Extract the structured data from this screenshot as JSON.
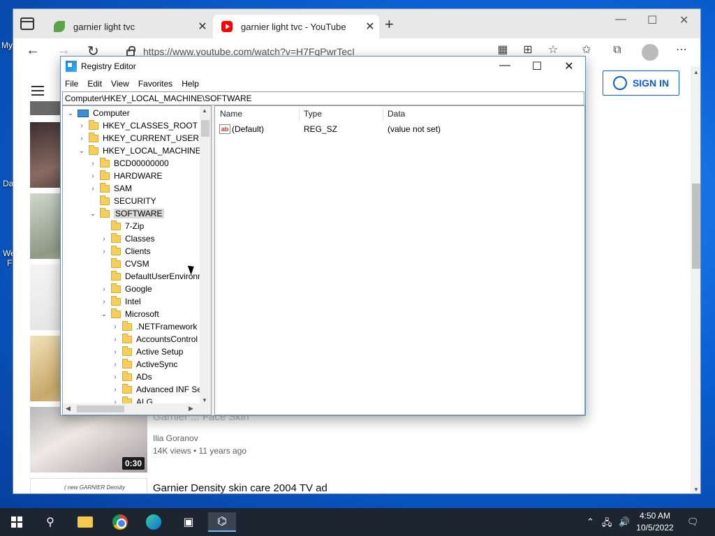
{
  "desktop": {
    "labels": [
      "My",
      "Da",
      "We",
      "F"
    ]
  },
  "browser": {
    "tabs": [
      {
        "title": "garnier light tvc",
        "icon": "leaf-icon"
      },
      {
        "title": "garnier light tvc - YouTube",
        "icon": "youtube-icon"
      }
    ],
    "url": "https://www.youtube.com/watch?v=H7FqPwrTecI",
    "window_controls": {
      "minimize": "—",
      "maximize": "☐",
      "close": "✕"
    }
  },
  "youtube": {
    "sign_in_label": "SIGN IN",
    "videos": [
      {
        "title": "Garnier ... Face Skin",
        "channel": "Ilia Goranov",
        "meta": "14K views • 11 years ago",
        "duration": "0:30"
      },
      {
        "title": "Garnier Density skin care 2004 TV ad",
        "thumb_text": "( new GARNIER Density"
      }
    ]
  },
  "regedit": {
    "title": "Registry Editor",
    "menu": [
      "File",
      "Edit",
      "View",
      "Favorites",
      "Help"
    ],
    "path": "Computer\\HKEY_LOCAL_MACHINE\\SOFTWARE",
    "tree": [
      {
        "label": "Computer",
        "level": 0,
        "expander": "v",
        "icon": "computer"
      },
      {
        "label": "HKEY_CLASSES_ROOT",
        "level": 1,
        "expander": ">",
        "icon": "folder"
      },
      {
        "label": "HKEY_CURRENT_USER",
        "level": 1,
        "expander": ">",
        "icon": "folder"
      },
      {
        "label": "HKEY_LOCAL_MACHINE",
        "level": 1,
        "expander": "v",
        "icon": "folder"
      },
      {
        "label": "BCD00000000",
        "level": 2,
        "expander": ">",
        "icon": "folder"
      },
      {
        "label": "HARDWARE",
        "level": 2,
        "expander": ">",
        "icon": "folder"
      },
      {
        "label": "SAM",
        "level": 2,
        "expander": ">",
        "icon": "folder"
      },
      {
        "label": "SECURITY",
        "level": 2,
        "expander": "",
        "icon": "folder"
      },
      {
        "label": "SOFTWARE",
        "level": 2,
        "expander": "v",
        "icon": "folder",
        "selected": true
      },
      {
        "label": "7-Zip",
        "level": 3,
        "expander": "",
        "icon": "folder"
      },
      {
        "label": "Classes",
        "level": 3,
        "expander": ">",
        "icon": "folder"
      },
      {
        "label": "Clients",
        "level": 3,
        "expander": ">",
        "icon": "folder"
      },
      {
        "label": "CVSM",
        "level": 3,
        "expander": "",
        "icon": "folder"
      },
      {
        "label": "DefaultUserEnvironn",
        "level": 3,
        "expander": "",
        "icon": "folder"
      },
      {
        "label": "Google",
        "level": 3,
        "expander": ">",
        "icon": "folder"
      },
      {
        "label": "Intel",
        "level": 3,
        "expander": ">",
        "icon": "folder"
      },
      {
        "label": "Microsoft",
        "level": 3,
        "expander": "v",
        "icon": "folder"
      },
      {
        "label": ".NETFramework",
        "level": 4,
        "expander": ">",
        "icon": "folder"
      },
      {
        "label": "AccountsControl",
        "level": 4,
        "expander": ">",
        "icon": "folder"
      },
      {
        "label": "Active Setup",
        "level": 4,
        "expander": ">",
        "icon": "folder"
      },
      {
        "label": "ActiveSync",
        "level": 4,
        "expander": ">",
        "icon": "folder"
      },
      {
        "label": "ADs",
        "level": 4,
        "expander": ">",
        "icon": "folder"
      },
      {
        "label": "Advanced INF Set",
        "level": 4,
        "expander": ">",
        "icon": "folder"
      },
      {
        "label": "ALG",
        "level": 4,
        "expander": ">",
        "icon": "folder"
      }
    ],
    "columns": [
      "Name",
      "Type",
      "Data"
    ],
    "values": [
      {
        "name": "(Default)",
        "type": "REG_SZ",
        "data": "(value not set)"
      }
    ]
  },
  "taskbar": {
    "time": "4:50 AM",
    "date": "10/5/2022"
  }
}
